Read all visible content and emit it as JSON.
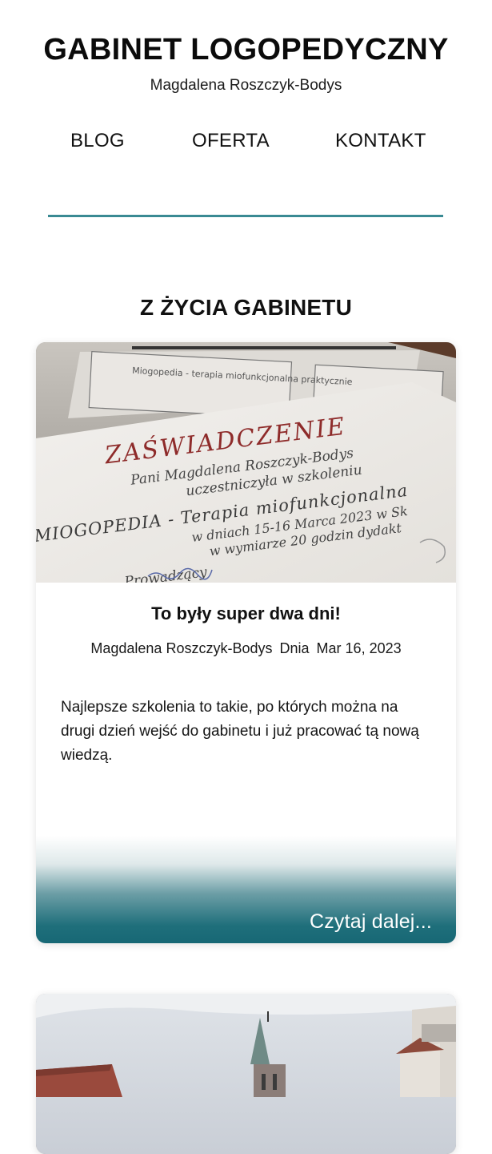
{
  "site": {
    "title": "GABINET LOGOPEDYCZNY",
    "subtitle": "Magdalena Roszczyk-Bodys"
  },
  "nav": {
    "items": [
      "BLOG",
      "OFERTA",
      "KONTAKT"
    ]
  },
  "section": {
    "title": "Z ŻYCIA GABINETU"
  },
  "posts": [
    {
      "image_text": {
        "heading": "ZAŚWIADCZENIE",
        "line1": "Pani Magdalena Roszczyk-Bodys",
        "line2": "uczestniczyła w szkoleniu",
        "line3": "MIOGOPEDIA - Terapia miofunkcjonalna",
        "line4": "w dniach 15-16 Marca 2023 w Sk",
        "line5": "w wymiarze 20 godzin dydakt",
        "line6": "Prowadzący",
        "booklet": "Miogopedia - terapia miofunkcjonalna praktycznie"
      },
      "title": "To były super dwa dni!",
      "author": "Magdalena Roszczyk-Bodys",
      "date_prefix": "Dnia",
      "date": "Mar 16, 2023",
      "excerpt": "Najlepsze szkolenia to takie, po których można na drugi dzień wejść do gabinetu i już pracować tą nową wiedzą.",
      "read_more": "Czytaj dalej..."
    }
  ],
  "colors": {
    "accent": "#3a8a93",
    "card_fade": "#0e5f6e"
  }
}
